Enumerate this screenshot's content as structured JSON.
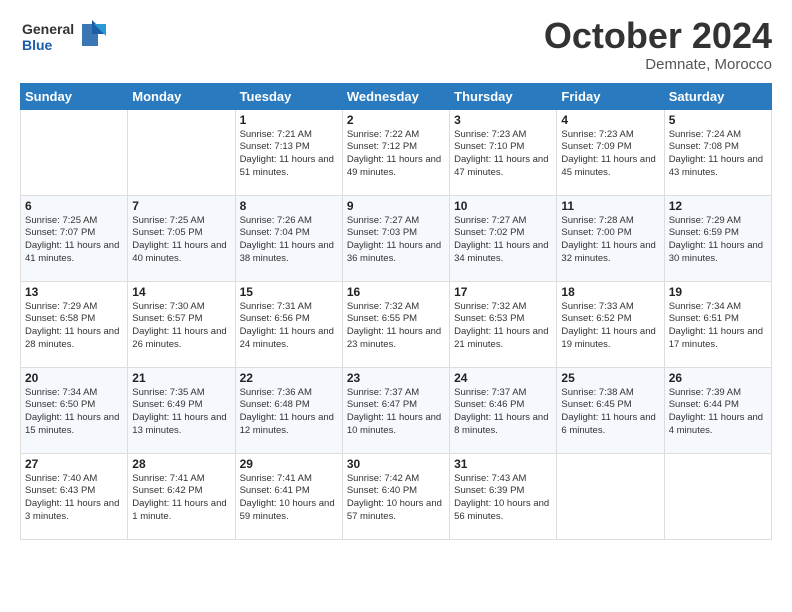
{
  "logo": {
    "line1": "General",
    "line2": "Blue"
  },
  "header": {
    "month": "October 2024",
    "location": "Demnate, Morocco"
  },
  "weekdays": [
    "Sunday",
    "Monday",
    "Tuesday",
    "Wednesday",
    "Thursday",
    "Friday",
    "Saturday"
  ],
  "weeks": [
    [
      {
        "day": "",
        "info": ""
      },
      {
        "day": "",
        "info": ""
      },
      {
        "day": "1",
        "info": "Sunrise: 7:21 AM\nSunset: 7:13 PM\nDaylight: 11 hours and 51 minutes."
      },
      {
        "day": "2",
        "info": "Sunrise: 7:22 AM\nSunset: 7:12 PM\nDaylight: 11 hours and 49 minutes."
      },
      {
        "day": "3",
        "info": "Sunrise: 7:23 AM\nSunset: 7:10 PM\nDaylight: 11 hours and 47 minutes."
      },
      {
        "day": "4",
        "info": "Sunrise: 7:23 AM\nSunset: 7:09 PM\nDaylight: 11 hours and 45 minutes."
      },
      {
        "day": "5",
        "info": "Sunrise: 7:24 AM\nSunset: 7:08 PM\nDaylight: 11 hours and 43 minutes."
      }
    ],
    [
      {
        "day": "6",
        "info": "Sunrise: 7:25 AM\nSunset: 7:07 PM\nDaylight: 11 hours and 41 minutes."
      },
      {
        "day": "7",
        "info": "Sunrise: 7:25 AM\nSunset: 7:05 PM\nDaylight: 11 hours and 40 minutes."
      },
      {
        "day": "8",
        "info": "Sunrise: 7:26 AM\nSunset: 7:04 PM\nDaylight: 11 hours and 38 minutes."
      },
      {
        "day": "9",
        "info": "Sunrise: 7:27 AM\nSunset: 7:03 PM\nDaylight: 11 hours and 36 minutes."
      },
      {
        "day": "10",
        "info": "Sunrise: 7:27 AM\nSunset: 7:02 PM\nDaylight: 11 hours and 34 minutes."
      },
      {
        "day": "11",
        "info": "Sunrise: 7:28 AM\nSunset: 7:00 PM\nDaylight: 11 hours and 32 minutes."
      },
      {
        "day": "12",
        "info": "Sunrise: 7:29 AM\nSunset: 6:59 PM\nDaylight: 11 hours and 30 minutes."
      }
    ],
    [
      {
        "day": "13",
        "info": "Sunrise: 7:29 AM\nSunset: 6:58 PM\nDaylight: 11 hours and 28 minutes."
      },
      {
        "day": "14",
        "info": "Sunrise: 7:30 AM\nSunset: 6:57 PM\nDaylight: 11 hours and 26 minutes."
      },
      {
        "day": "15",
        "info": "Sunrise: 7:31 AM\nSunset: 6:56 PM\nDaylight: 11 hours and 24 minutes."
      },
      {
        "day": "16",
        "info": "Sunrise: 7:32 AM\nSunset: 6:55 PM\nDaylight: 11 hours and 23 minutes."
      },
      {
        "day": "17",
        "info": "Sunrise: 7:32 AM\nSunset: 6:53 PM\nDaylight: 11 hours and 21 minutes."
      },
      {
        "day": "18",
        "info": "Sunrise: 7:33 AM\nSunset: 6:52 PM\nDaylight: 11 hours and 19 minutes."
      },
      {
        "day": "19",
        "info": "Sunrise: 7:34 AM\nSunset: 6:51 PM\nDaylight: 11 hours and 17 minutes."
      }
    ],
    [
      {
        "day": "20",
        "info": "Sunrise: 7:34 AM\nSunset: 6:50 PM\nDaylight: 11 hours and 15 minutes."
      },
      {
        "day": "21",
        "info": "Sunrise: 7:35 AM\nSunset: 6:49 PM\nDaylight: 11 hours and 13 minutes."
      },
      {
        "day": "22",
        "info": "Sunrise: 7:36 AM\nSunset: 6:48 PM\nDaylight: 11 hours and 12 minutes."
      },
      {
        "day": "23",
        "info": "Sunrise: 7:37 AM\nSunset: 6:47 PM\nDaylight: 11 hours and 10 minutes."
      },
      {
        "day": "24",
        "info": "Sunrise: 7:37 AM\nSunset: 6:46 PM\nDaylight: 11 hours and 8 minutes."
      },
      {
        "day": "25",
        "info": "Sunrise: 7:38 AM\nSunset: 6:45 PM\nDaylight: 11 hours and 6 minutes."
      },
      {
        "day": "26",
        "info": "Sunrise: 7:39 AM\nSunset: 6:44 PM\nDaylight: 11 hours and 4 minutes."
      }
    ],
    [
      {
        "day": "27",
        "info": "Sunrise: 7:40 AM\nSunset: 6:43 PM\nDaylight: 11 hours and 3 minutes."
      },
      {
        "day": "28",
        "info": "Sunrise: 7:41 AM\nSunset: 6:42 PM\nDaylight: 11 hours and 1 minute."
      },
      {
        "day": "29",
        "info": "Sunrise: 7:41 AM\nSunset: 6:41 PM\nDaylight: 10 hours and 59 minutes."
      },
      {
        "day": "30",
        "info": "Sunrise: 7:42 AM\nSunset: 6:40 PM\nDaylight: 10 hours and 57 minutes."
      },
      {
        "day": "31",
        "info": "Sunrise: 7:43 AM\nSunset: 6:39 PM\nDaylight: 10 hours and 56 minutes."
      },
      {
        "day": "",
        "info": ""
      },
      {
        "day": "",
        "info": ""
      }
    ]
  ]
}
